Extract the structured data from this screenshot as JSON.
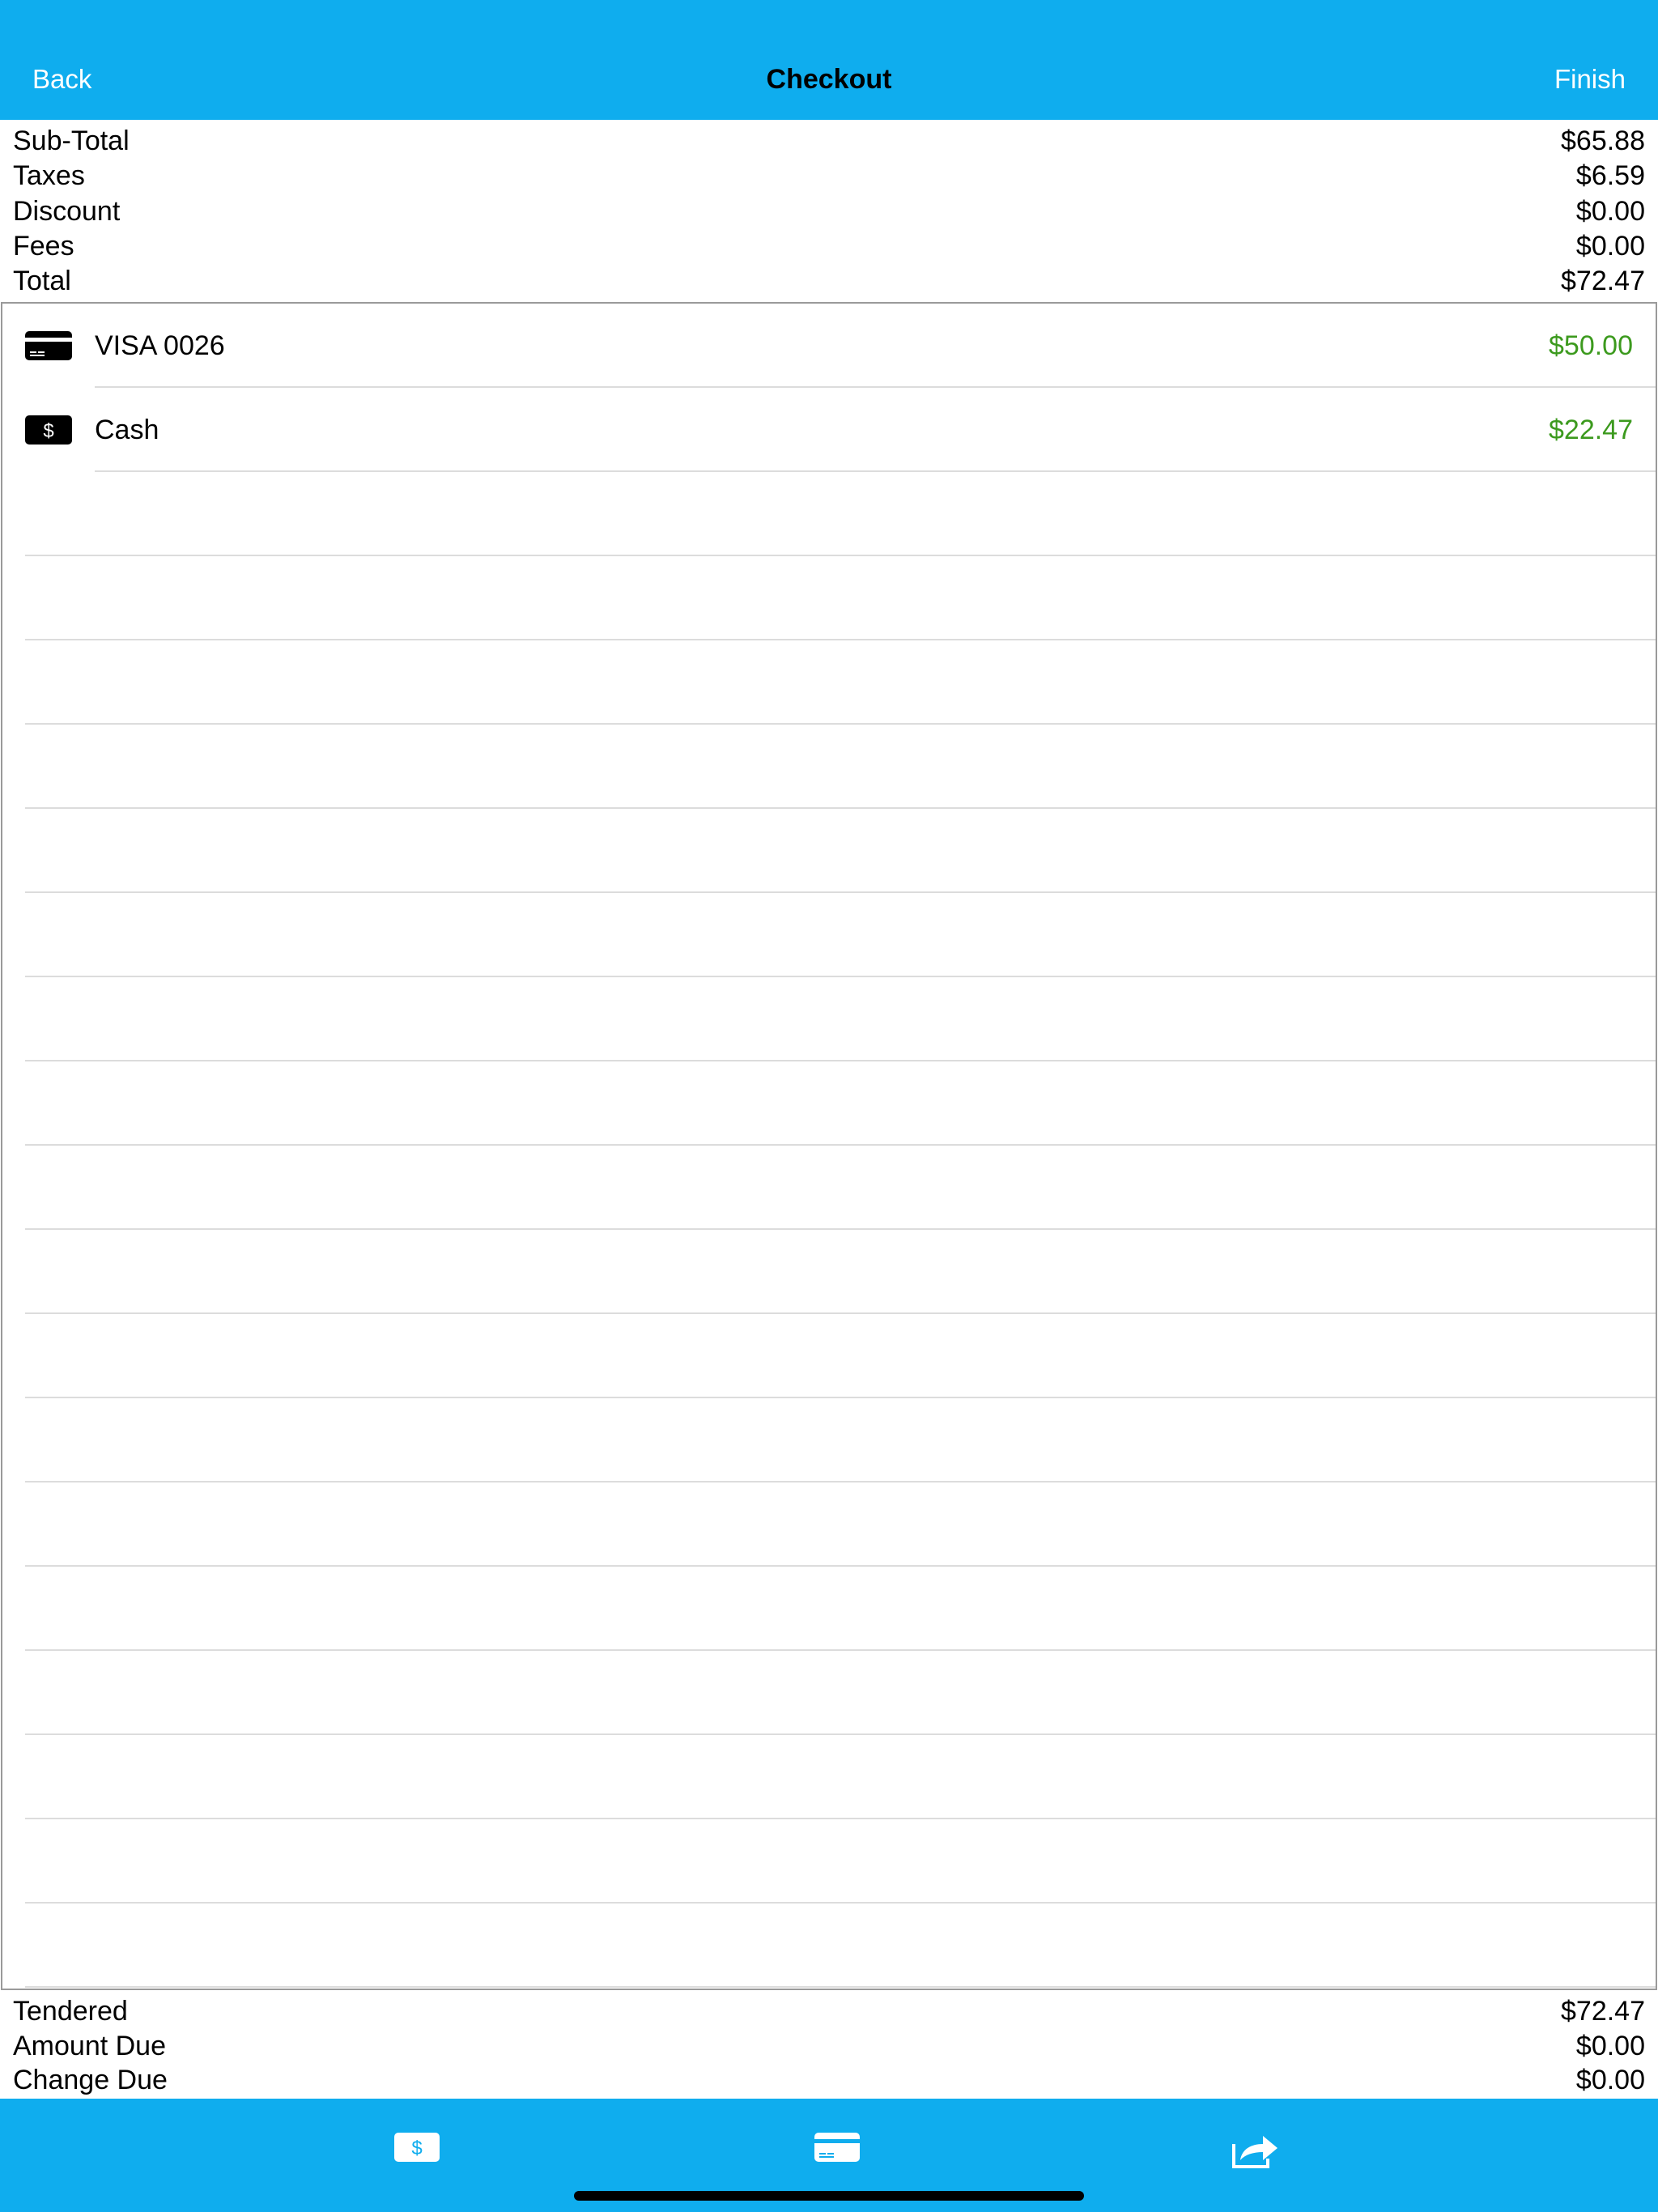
{
  "navbar": {
    "back_label": "Back",
    "title": "Checkout",
    "finish_label": "Finish",
    "background_color": "#0fadee"
  },
  "summary": {
    "sub_total": {
      "label": "Sub-Total",
      "value": "$65.88"
    },
    "taxes": {
      "label": "Taxes",
      "value": "$6.59"
    },
    "discount": {
      "label": "Discount",
      "value": "$0.00"
    },
    "fees": {
      "label": "Fees",
      "value": "$0.00"
    },
    "total": {
      "label": "Total",
      "value": "$72.47"
    }
  },
  "payments": [
    {
      "icon": "credit-card-icon",
      "label": "VISA 0026",
      "amount": "$50.00"
    },
    {
      "icon": "cash-icon",
      "label": "Cash",
      "amount": "$22.47"
    }
  ],
  "payment_amount_color": "#3c9a1e",
  "totals": {
    "tendered": {
      "label": "Tendered",
      "value": "$72.47"
    },
    "amount_due": {
      "label": "Amount Due",
      "value": "$0.00"
    },
    "change_due": {
      "label": "Change Due",
      "value": "$0.00"
    }
  },
  "toolbar": {
    "buttons": [
      {
        "icon": "cash-icon",
        "action": "add-cash-payment"
      },
      {
        "icon": "credit-card-icon",
        "action": "add-card-payment"
      },
      {
        "icon": "share-icon",
        "action": "share-receipt"
      }
    ]
  }
}
